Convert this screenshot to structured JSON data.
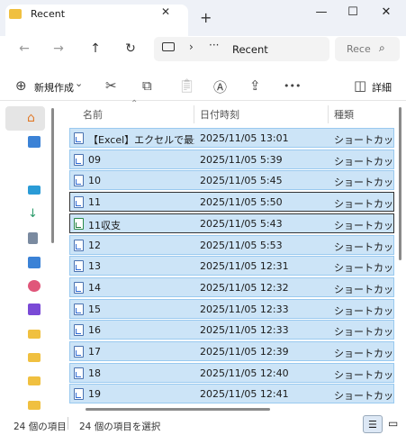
{
  "window": {
    "tab_title": "Recent",
    "tab_close": "✕",
    "new_tab": "+",
    "minimize": "—",
    "maximize": "☐",
    "close": "✕"
  },
  "nav": {
    "address_segments": [
      "this-pc-icon",
      "›",
      "···",
      "Recent"
    ],
    "address_current": "Recent",
    "address_chevron": "›",
    "address_ellipsis": "···",
    "search_placeholder": "Rece",
    "back": "←",
    "forward": "→",
    "up": "↑",
    "refresh": "↻"
  },
  "toolbar": {
    "new_label": "新規作成",
    "new_chevron": "⌄",
    "more": "•••",
    "details_label": "詳細"
  },
  "columns": {
    "name": "名前",
    "date": "日付時刻",
    "type": "種類"
  },
  "files": [
    {
      "name": "【Excel】エクセルで最近使...",
      "date": "2025/11/05 13:01",
      "type": "ショートカット",
      "icon": "shortcut-icon"
    },
    {
      "name": "09",
      "date": "2025/11/05 5:39",
      "type": "ショートカット",
      "icon": "shortcut-icon"
    },
    {
      "name": "10",
      "date": "2025/11/05 5:45",
      "type": "ショートカット",
      "icon": "shortcut-icon"
    },
    {
      "name": "11",
      "date": "2025/11/05 5:50",
      "type": "ショートカット",
      "icon": "shortcut-icon"
    },
    {
      "name": "11収支",
      "date": "2025/11/05 5:43",
      "type": "ショートカット",
      "icon": "excel-shortcut-icon"
    },
    {
      "name": "12",
      "date": "2025/11/05 5:53",
      "type": "ショートカット",
      "icon": "shortcut-icon"
    },
    {
      "name": "13",
      "date": "2025/11/05 12:31",
      "type": "ショートカット",
      "icon": "shortcut-icon"
    },
    {
      "name": "14",
      "date": "2025/11/05 12:32",
      "type": "ショートカット",
      "icon": "shortcut-icon"
    },
    {
      "name": "15",
      "date": "2025/11/05 12:33",
      "type": "ショートカット",
      "icon": "shortcut-icon"
    },
    {
      "name": "16",
      "date": "2025/11/05 12:33",
      "type": "ショートカット",
      "icon": "shortcut-icon"
    },
    {
      "name": "17",
      "date": "2025/11/05 12:39",
      "type": "ショートカット",
      "icon": "shortcut-icon"
    },
    {
      "name": "18",
      "date": "2025/11/05 12:40",
      "type": "ショートカット",
      "icon": "shortcut-icon"
    },
    {
      "name": "19",
      "date": "2025/11/05 12:41",
      "type": "ショートカット",
      "icon": "shortcut-icon"
    }
  ],
  "status": {
    "count": "24 個の項目",
    "selected": "24 個の項目を選択"
  },
  "colors": {
    "selection": "#cce4f7",
    "selection_border": "#99c9ef",
    "folder": "#f0c040",
    "accent": "#2e6bd6"
  }
}
